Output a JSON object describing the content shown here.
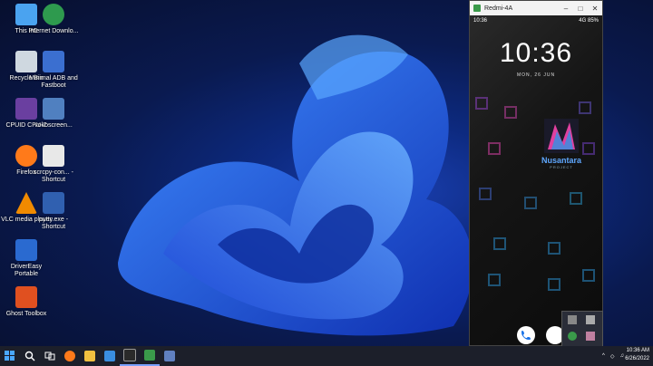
{
  "desktop_icons": [
    {
      "label": "This PC",
      "icon": "computer-icon",
      "color": "#4aa3f0"
    },
    {
      "label": "Internet Downlo...",
      "icon": "download-globe-icon",
      "color": "#2e9a4e"
    },
    {
      "label": "Recycle Bin",
      "icon": "recycle-bin-icon",
      "color": "#cfd8e0"
    },
    {
      "label": "Minimal ADB and Fastboot",
      "icon": "adb-icon",
      "color": "#3b6fd0"
    },
    {
      "label": "CPUID CPU-Z",
      "icon": "cpu-icon",
      "color": "#6a3fa0"
    },
    {
      "label": "vokoscreen...",
      "icon": "screen-recorder-icon",
      "color": "#5080c0"
    },
    {
      "label": "Firefox",
      "icon": "firefox-icon",
      "color": "#ff7a1a"
    },
    {
      "label": "scrcpy-con... - Shortcut",
      "icon": "scrcpy-icon",
      "color": "#e8e8e8"
    },
    {
      "label": "VLC media player",
      "icon": "vlc-icon",
      "color": "#f08a00"
    },
    {
      "label": "putty.exe - Shortcut",
      "icon": "putty-icon",
      "color": "#3060b0"
    },
    {
      "label": "DriverEasy Portable",
      "icon": "drivereasy-icon",
      "color": "#2a6ad0"
    },
    {
      "label": "Ghost Toolbox",
      "icon": "ghost-icon",
      "color": "#e05020"
    }
  ],
  "phone": {
    "window_title": "Redmi-4A",
    "status_time": "10:36",
    "status_battery": "85%",
    "status_signal": "4G",
    "clock": "10:36",
    "date": "MON, 26 JUN",
    "logo_text": "Nusantara",
    "logo_sub": "PROJECT"
  },
  "taskbar": {
    "time": "10:36 AM",
    "date": "6/26/2022",
    "icons": [
      {
        "name": "start-icon",
        "color": "#4aa8ff"
      },
      {
        "name": "search-icon",
        "color": "#ffffff"
      },
      {
        "name": "task-view-icon",
        "color": "#ffffff"
      },
      {
        "name": "firefox-icon",
        "color": "#ff7a1a"
      },
      {
        "name": "file-explorer-icon",
        "color": "#f0c040"
      },
      {
        "name": "mail-icon",
        "color": "#3a8ee0"
      },
      {
        "name": "terminal-icon",
        "color": "#2a2a2a"
      },
      {
        "name": "android-icon",
        "color": "#3a9a4a"
      },
      {
        "name": "app-icon",
        "color": "#6080c0"
      }
    ]
  }
}
